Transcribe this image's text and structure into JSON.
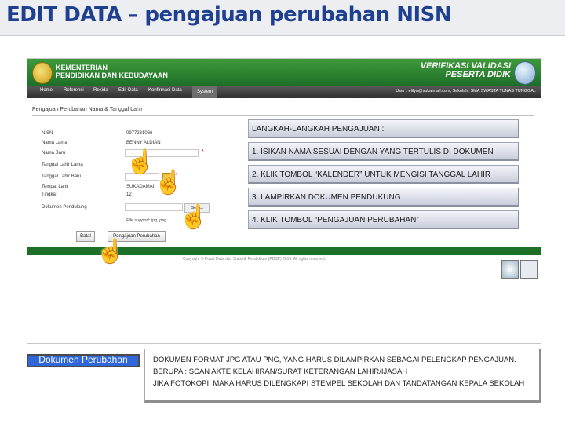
{
  "slide_title": "EDIT DATA – pengajuan perubahan NISN",
  "app": {
    "ministry_line1": "KEMENTERIAN",
    "ministry_line2": "PENDIDIKAN DAN KEBUDAYAAN",
    "verif_line1": "VERIFIKASI VALIDASI",
    "verif_line2": "PESERTA DIDIK",
    "nav": [
      "Home",
      "Referensi",
      "Rekida",
      "Edit Data",
      "Konfirmasi Data",
      "System"
    ],
    "active_nav": "System",
    "user_info": "User : elilyn@sukaimail.com, Sekolah: SMA SWASTA TUNAS TUNGGAL"
  },
  "form": {
    "heading": "Pengajuan Perubahan Nama & Tanggal Lahir",
    "fields": [
      {
        "label": "NISN",
        "value": "0977231066"
      },
      {
        "label": "Nama Lama",
        "value": "BENNY ALDIAN"
      },
      {
        "label": "Nama Baru",
        "value": ""
      },
      {
        "label": "Tanggal Lahir Lama",
        "value": ""
      },
      {
        "label": "Tanggal Lahir Baru",
        "value": ""
      },
      {
        "label": "Tempat Lahir",
        "value": "SUKADAMAI"
      },
      {
        "label": "Tingkat",
        "value": "12"
      },
      {
        "label": "Dokumen Pendukung",
        "value": ""
      }
    ],
    "select_button": "Select",
    "file_note": "File support: jpg, png",
    "cancel_button": "Batal",
    "submit_button": "Pengajuan Perubahan",
    "copyright": "Copyright © Pusat Data dan Statistik Pendidikan (PDSP) 2013. All rights reserved."
  },
  "steps": [
    "LANGKAH-LANGKAH PENGAJUAN :",
    "1. ISIKAN NAMA SESUAI DENGAN YANG TERTULIS DI DOKUMEN",
    "2. KLIK TOMBOL “KALENDER” UNTUK MENGISI TANGGAL LAHIR",
    "3. LAMPIRKAN DOKUMEN PENDUKUNG",
    "4. KLIK TOMBOL “PENGAJUAN PERUBAHAN”"
  ],
  "dokumen": {
    "label": "Dokumen Perubahan",
    "desc_line1": "DOKUMEN FORMAT JPG ATAU PNG, YANG HARUS DILAMPIRKAN SEBAGAI PELENGKAP PENGAJUAN.",
    "desc_line2": "BERUPA : SCAN AKTE KELAHIRAN/SURAT KETERANGAN LAHIR/IJASAH",
    "desc_line3": "JIKA FOTOKOPI, MAKA HARUS DILENGKAPI STEMPEL SEKOLAH DAN TANDATANGAN KEPALA SEKOLAH"
  },
  "icons": {
    "pointer": "hand-pointer-icon",
    "calendar": "calendar-icon"
  },
  "colors": {
    "title": "#1f3f8f",
    "banner_green": "#1e6f28",
    "label_blue": "#2f66d8"
  }
}
